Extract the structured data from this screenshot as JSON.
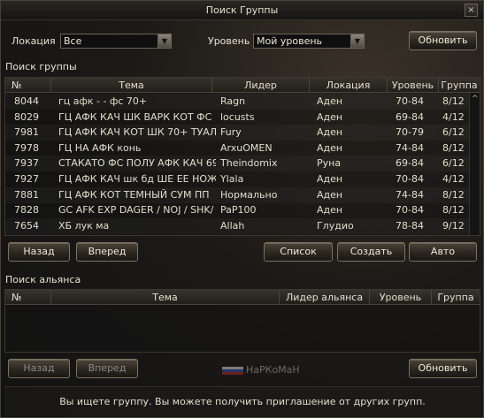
{
  "window": {
    "title": "Поиск Группы",
    "close_glyph": "×"
  },
  "filters": {
    "location_label": "Локация",
    "location_value": "Все",
    "level_label": "Уровень",
    "level_value": "Мой уровень",
    "refresh_label": "Обновить"
  },
  "party_section": {
    "title": "Поиск группы",
    "columns": [
      "№",
      "Тема",
      "Лидер",
      "Локация",
      "Уровень",
      "Группа"
    ],
    "rows": [
      [
        "8044",
        "гц афк -  - фс 70+",
        "Ragn",
        "Аден",
        "70-84",
        "8/12"
      ],
      [
        "8029",
        "ГЦ АФК КАЧ ШК ВАРК КОТ ФС",
        "locusts",
        "Аден",
        "69-84",
        "4/12"
      ],
      [
        "7981",
        "ГЦ АФК КАЧ  КОТ  ШК  70+ ТУАЛ",
        "Fury",
        "Аден",
        "70-79",
        "6/12"
      ],
      [
        "7978",
        "ГЦ НА АФК конь",
        "ArxuOMEN",
        "Аден",
        "74-84",
        "8/12"
      ],
      [
        "7937",
        "СТАКАТО ФС ПОЛУ АФК КАЧ 69 -",
        "Theindomix",
        "Руна",
        "69-84",
        "6/12"
      ],
      [
        "7927",
        "ГЦ АФК КАЧ шк бд  ШЕ ЕЕ НОЖ Ф",
        "Ylala",
        "Аден",
        "70-84",
        "4/12"
      ],
      [
        "7881",
        "ГЦ АФК КОТ ТЕМНЫЙ СУМ  ПП",
        "Нормально",
        "Аден",
        "74-84",
        "8/12"
      ],
      [
        "7828",
        "GC AFK EXP DAGER / NOJ / SHK/ PA",
        "PaP100",
        "Аден",
        "70-84",
        "8/12"
      ],
      [
        "7654",
        "ХБ лук ма",
        "Allah",
        "Глудио",
        "78-84",
        "9/12"
      ]
    ],
    "back_label": "Назад",
    "forward_label": "Вперед",
    "list_label": "Список",
    "create_label": "Создать",
    "auto_label": "Авто"
  },
  "alliance_section": {
    "title": "Поиск альянса",
    "columns": [
      "№",
      "Тема",
      "Лидер альянса",
      "Уровень",
      "Группа"
    ],
    "back_label": "Назад",
    "forward_label": "Вперед",
    "refresh_label": "Обновить"
  },
  "watermark": "НаРКоМаН",
  "status_text": "Вы ищете группу. Вы можете получить приглашение от других групп.",
  "icons": {
    "dropdown": "chevron-down-icon",
    "scroll_up": "scroll-up-icon",
    "close": "close-icon"
  },
  "colors": {
    "panel_bg": "#1c1a17",
    "text": "#e2dccb",
    "border": "#4a453b"
  }
}
